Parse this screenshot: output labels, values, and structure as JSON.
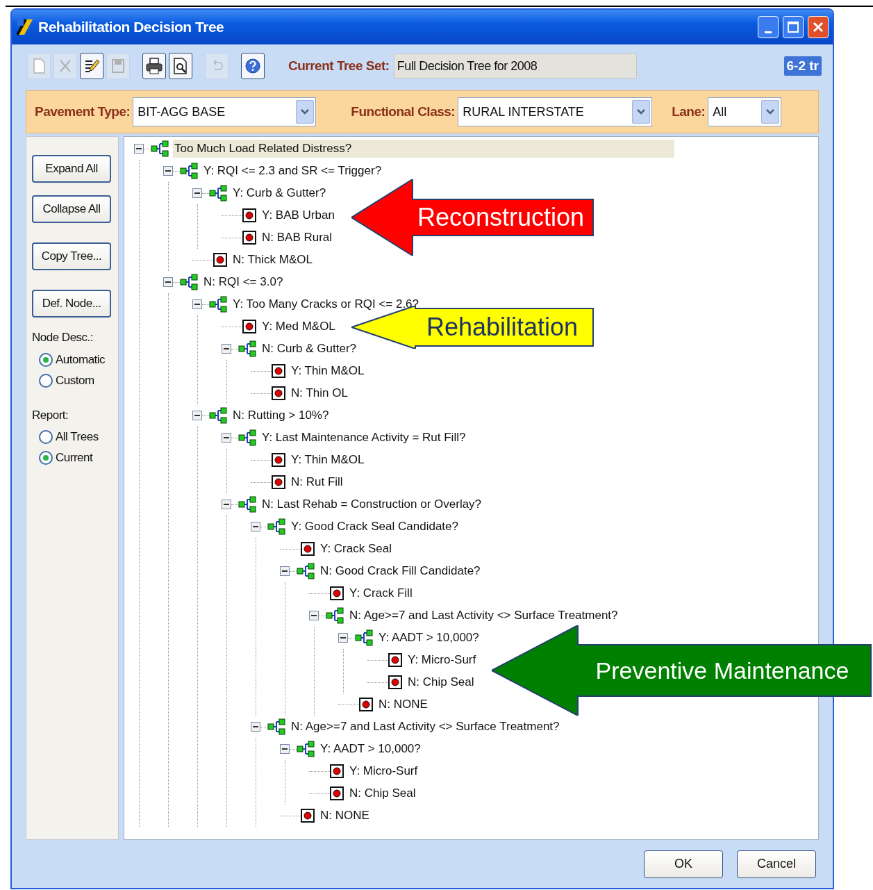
{
  "window": {
    "title": "Rehabilitation Decision Tree"
  },
  "toolbar": [
    {
      "kind": "new",
      "disabled": true
    },
    {
      "kind": "delete",
      "disabled": true
    },
    {
      "kind": "edit",
      "disabled": false
    },
    {
      "kind": "save",
      "disabled": true
    },
    {
      "kind": "print",
      "disabled": false
    },
    {
      "kind": "preview",
      "disabled": false
    },
    {
      "kind": "undo",
      "disabled": true
    },
    {
      "kind": "help",
      "disabled": false
    }
  ],
  "current_tree_set": {
    "label": "Current Tree Set:",
    "value": "Full Decision Tree for 2008"
  },
  "corner_text": "6-2 tr",
  "filters": [
    {
      "label": "Pavement Type:",
      "value": "BIT-AGG BASE"
    },
    {
      "label": "Functional Class:",
      "value": "RURAL INTERSTATE"
    },
    {
      "label": "Lane:",
      "value": "All"
    }
  ],
  "sidebar": {
    "buttons": [
      "Expand All",
      "Collapse All",
      "Copy Tree...",
      "Def. Node..."
    ],
    "groups": [
      {
        "label": "Node Desc.:",
        "options": [
          {
            "label": "Automatic",
            "selected": true
          },
          {
            "label": "Custom",
            "selected": false
          }
        ]
      },
      {
        "label": "Report:",
        "options": [
          {
            "label": "All Trees",
            "selected": false
          },
          {
            "label": "Current",
            "selected": true
          }
        ]
      }
    ]
  },
  "tree": [
    {
      "kind": "decision",
      "label": "Too Much Load Related Distress?",
      "selected": true,
      "expanded": true,
      "children": [
        {
          "kind": "decision",
          "label": "Y: RQI <= 2.3 and SR <= Trigger?",
          "selected": false,
          "expanded": true,
          "children": [
            {
              "kind": "decision",
              "label": "Y: Curb & Gutter?",
              "selected": false,
              "expanded": true,
              "children": [
                {
                  "kind": "action",
                  "label": "Y: BAB Urban",
                  "selected": false
                },
                {
                  "kind": "action",
                  "label": "N: BAB Rural",
                  "selected": false
                }
              ]
            },
            {
              "kind": "action",
              "label": "N: Thick M&OL",
              "selected": false
            }
          ]
        },
        {
          "kind": "decision",
          "label": "N: RQI <= 3.0?",
          "selected": false,
          "expanded": true,
          "children": [
            {
              "kind": "decision",
              "label": "Y: Too Many Cracks or RQI <= 2.6?",
              "selected": false,
              "expanded": true,
              "children": [
                {
                  "kind": "action",
                  "label": "Y: Med M&OL",
                  "selected": false
                },
                {
                  "kind": "decision",
                  "label": "N: Curb & Gutter?",
                  "selected": false,
                  "expanded": true,
                  "children": [
                    {
                      "kind": "action",
                      "label": "Y: Thin M&OL",
                      "selected": false
                    },
                    {
                      "kind": "action",
                      "label": "N: Thin OL",
                      "selected": false
                    }
                  ]
                }
              ]
            },
            {
              "kind": "decision",
              "label": "N: Rutting > 10%?",
              "selected": false,
              "expanded": true,
              "children": [
                {
                  "kind": "decision",
                  "label": "Y: Last Maintenance Activity = Rut Fill?",
                  "selected": false,
                  "expanded": true,
                  "children": [
                    {
                      "kind": "action",
                      "label": "Y: Thin M&OL",
                      "selected": false
                    },
                    {
                      "kind": "action",
                      "label": "N: Rut Fill",
                      "selected": false
                    }
                  ]
                },
                {
                  "kind": "decision",
                  "label": "N: Last Rehab = Construction or Overlay?",
                  "selected": false,
                  "expanded": true,
                  "children": [
                    {
                      "kind": "decision",
                      "label": "Y: Good Crack Seal Candidate?",
                      "selected": false,
                      "expanded": true,
                      "children": [
                        {
                          "kind": "action",
                          "label": "Y: Crack Seal",
                          "selected": false
                        },
                        {
                          "kind": "decision",
                          "label": "N: Good Crack Fill Candidate?",
                          "selected": false,
                          "expanded": true,
                          "children": [
                            {
                              "kind": "action",
                              "label": "Y: Crack Fill",
                              "selected": false
                            },
                            {
                              "kind": "decision",
                              "label": "N: Age>=7 and Last Activity <> Surface Treatment?",
                              "selected": false,
                              "expanded": true,
                              "children": [
                                {
                                  "kind": "decision",
                                  "label": "Y: AADT > 10,000?",
                                  "selected": false,
                                  "expanded": true,
                                  "children": [
                                    {
                                      "kind": "action",
                                      "label": "Y: Micro-Surf",
                                      "selected": false
                                    },
                                    {
                                      "kind": "action",
                                      "label": "N: Chip Seal",
                                      "selected": false
                                    }
                                  ]
                                },
                                {
                                  "kind": "action",
                                  "label": "N: NONE",
                                  "selected": false
                                }
                              ]
                            }
                          ]
                        }
                      ]
                    },
                    {
                      "kind": "decision",
                      "label": "N: Age>=7 and Last Activity <> Surface Treatment?",
                      "selected": false,
                      "expanded": true,
                      "children": [
                        {
                          "kind": "decision",
                          "label": "Y: AADT > 10,000?",
                          "selected": false,
                          "expanded": true,
                          "children": [
                            {
                              "kind": "action",
                              "label": "Y: Micro-Surf",
                              "selected": false
                            },
                            {
                              "kind": "action",
                              "label": "N: Chip Seal",
                              "selected": false
                            }
                          ]
                        },
                        {
                          "kind": "action",
                          "label": "N: NONE",
                          "selected": false
                        }
                      ]
                    }
                  ]
                }
              ]
            }
          ]
        }
      ]
    }
  ],
  "callouts": [
    {
      "text": "Reconstruction",
      "color": "#ff0000"
    },
    {
      "text": "Rehabilitation",
      "color": "#ffff00"
    },
    {
      "text": "Preventive Maintenance",
      "color": "#008000"
    }
  ],
  "buttons": [
    "OK",
    "Cancel"
  ]
}
